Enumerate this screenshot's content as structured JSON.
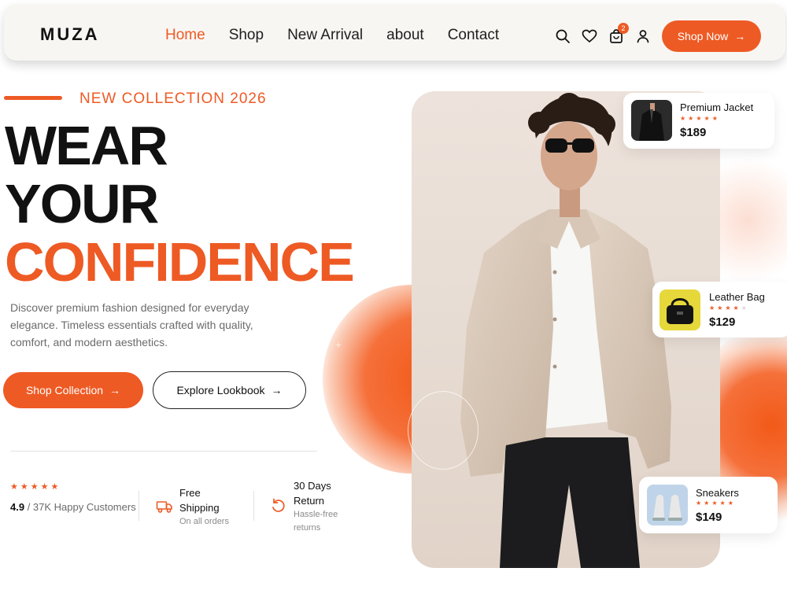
{
  "brand": {
    "logo": "MUZA",
    "accent_color": "#ee5a24"
  },
  "nav": {
    "links": [
      {
        "label": "Home",
        "active": true
      },
      {
        "label": "Shop",
        "active": false
      },
      {
        "label": "New Arrival",
        "active": false
      },
      {
        "label": "about",
        "active": false
      },
      {
        "label": "Contact",
        "active": false
      }
    ],
    "icons": [
      "search-icon",
      "heart-icon",
      "cart-icon",
      "user-icon"
    ],
    "cart_count": "2",
    "cta_label": "Shop Now"
  },
  "hero": {
    "kicker": "NEW COLLECTION 2026",
    "headline": [
      "WEAR",
      "YOUR",
      "CONFIDENCE"
    ],
    "description": "Discover premium fashion designed for everyday elegance. Timeless essentials crafted with quality, comfort, and modern aesthetics.",
    "primary_button": "Shop Collection",
    "secondary_button": "Explore Lookbook"
  },
  "stats": {
    "rating": {
      "stars": 5,
      "value": "4.9",
      "text": " / 37K Happy Customers"
    },
    "shipping": {
      "title": "Free Shipping",
      "sub": "On all orders"
    },
    "returns": {
      "title": "30 Days Return",
      "sub": "Hassle-free returns"
    }
  },
  "products": [
    {
      "name": "Premium Jacket",
      "price": "$189",
      "rating": 5
    },
    {
      "name": "Leather Bag",
      "price": "$129",
      "rating": 4
    },
    {
      "name": "Sneakers",
      "price": "$149",
      "rating": 5
    }
  ]
}
